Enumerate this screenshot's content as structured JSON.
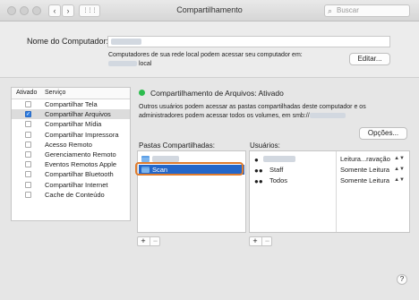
{
  "window": {
    "title": "Compartilhamento"
  },
  "toolbar": {
    "back_glyph": "‹",
    "forward_glyph": "›",
    "grid_glyph": "⋮⋮⋮",
    "search_placeholder": "Buscar",
    "search_icon": "search-icon"
  },
  "computer": {
    "label": "Nome do Computador:",
    "help_line1": "Computadores de sua rede local podem acessar seu computador em:",
    "help_line2_suffix": "local",
    "edit_button": "Editar..."
  },
  "services": {
    "header_enabled": "Ativado",
    "header_service": "Serviço",
    "items": [
      {
        "label": "Compartilhar Tela",
        "checked": false,
        "selected": false
      },
      {
        "label": "Compartilhar Arquivos",
        "checked": true,
        "selected": true
      },
      {
        "label": "Compartilhar Mídia",
        "checked": false,
        "selected": false
      },
      {
        "label": "Compartilhar Impressora",
        "checked": false,
        "selected": false
      },
      {
        "label": "Acesso Remoto",
        "checked": false,
        "selected": false
      },
      {
        "label": "Gerenciamento Remoto",
        "checked": false,
        "selected": false
      },
      {
        "label": "Eventos Remotos Apple",
        "checked": false,
        "selected": false
      },
      {
        "label": "Compartilhar Bluetooth",
        "checked": false,
        "selected": false
      },
      {
        "label": "Compartilhar Internet",
        "checked": false,
        "selected": false
      },
      {
        "label": "Cache de Conteúdo",
        "checked": false,
        "selected": false
      }
    ]
  },
  "detail": {
    "status": "Compartilhamento de Arquivos: Ativado",
    "status_color": "#2dbc4e",
    "desc_line1": "Outros usuários podem acessar as pastas compartilhadas deste computador e os",
    "desc_line2": "administradores podem acessar todos os volumes, em smb://",
    "options_button": "Opções..."
  },
  "folders": {
    "label": "Pastas Compartilhadas:",
    "items": [
      {
        "label": "",
        "selected": false
      },
      {
        "label": "Scan",
        "selected": true
      }
    ],
    "add": "+",
    "remove": "−"
  },
  "users": {
    "label": "Usuários:",
    "rows": [
      {
        "name": "",
        "icon": "user-icon",
        "permission": "Leitura...ravação"
      },
      {
        "name": "Staff",
        "icon": "group-icon",
        "permission": "Somente Leitura"
      },
      {
        "name": "Todos",
        "icon": "group-icon",
        "permission": "Somente Leitura"
      }
    ],
    "add": "+",
    "remove": "−"
  },
  "help_button": "?"
}
